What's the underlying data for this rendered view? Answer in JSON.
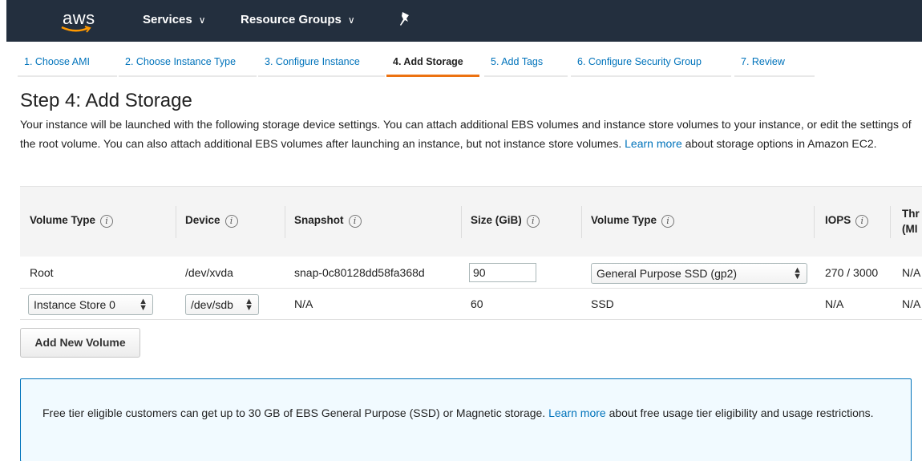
{
  "header": {
    "logo_text": "aws",
    "nav": [
      {
        "label": "Services"
      },
      {
        "label": "Resource Groups"
      }
    ],
    "pin_icon": "pin-icon"
  },
  "steps": [
    {
      "label": "1. Choose AMI",
      "active": false
    },
    {
      "label": "2. Choose Instance Type",
      "active": false
    },
    {
      "label": "3. Configure Instance",
      "active": false
    },
    {
      "label": "4. Add Storage",
      "active": true
    },
    {
      "label": "5. Add Tags",
      "active": false
    },
    {
      "label": "6. Configure Security Group",
      "active": false
    },
    {
      "label": "7. Review",
      "active": false
    }
  ],
  "page": {
    "title": "Step 4: Add Storage",
    "intro_text": "Your instance will be launched with the following storage device settings. You can attach additional EBS volumes and instance store volumes to your instance, or edit the settings of the root volume. You can also attach additional EBS volumes after launching an instance, but not instance store volumes.",
    "intro_link": "Learn more",
    "intro_tail": "about storage options in Amazon EC2."
  },
  "table": {
    "headers": {
      "volume_type": "Volume Type",
      "device": "Device",
      "snapshot": "Snapshot",
      "size": "Size (GiB)",
      "volume_type2": "Volume Type",
      "iops": "IOPS",
      "throughput_line1": "Thr",
      "throughput_line2": "(MI"
    },
    "rows": [
      {
        "volume_type": "Root",
        "device": "/dev/xvda",
        "snapshot": "snap-0c80128dd58fa368d",
        "size": "90",
        "vtype": "General Purpose SSD (gp2)",
        "iops": "270 / 3000",
        "throughput": "N/A"
      },
      {
        "volume_type": "Instance Store 0",
        "device": "/dev/sdb",
        "snapshot": "N/A",
        "size": "60",
        "vtype": "SSD",
        "iops": "N/A",
        "throughput": "N/A"
      }
    ]
  },
  "add_button": "Add New Volume",
  "notice": {
    "text": "Free tier eligible customers can get up to 30 GB of EBS General Purpose (SSD) or Magnetic storage.",
    "link": "Learn more",
    "tail": "about free usage tier eligibility and usage restrictions."
  },
  "colors": {
    "topbar": "#232f3e",
    "link": "#0073bb",
    "active_tab": "#ec7211",
    "notice_bg": "#f1faff"
  }
}
